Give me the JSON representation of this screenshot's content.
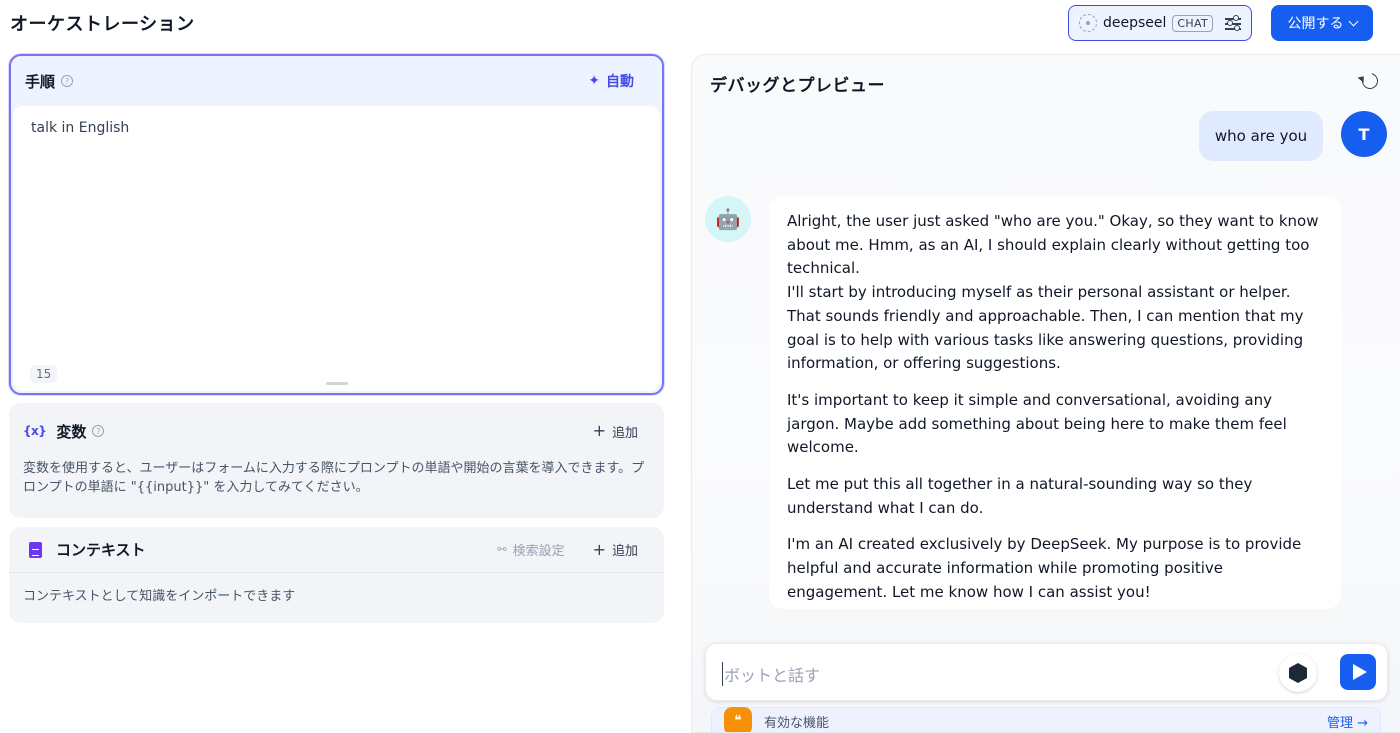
{
  "header": {
    "title": "オーケストレーション",
    "model": {
      "name": "deepseel",
      "badge": "CHAT"
    },
    "publish_label": "公開する"
  },
  "instructions": {
    "title": "手順",
    "help": "?",
    "auto_label": "自動",
    "text": "talk in English",
    "char_count": "15"
  },
  "variables": {
    "icon": "{x}",
    "title": "変数",
    "help": "?",
    "add_label": "追加",
    "description": "変数を使用すると、ユーザーはフォームに入力する際にプロンプトの単語や開始の言葉を導入できます。プロンプトの単語に \"{{input}}\" を入力してみてください。"
  },
  "context": {
    "title": "コンテキスト",
    "retrieval_label": "検索設定",
    "add_label": "追加",
    "description": "コンテキストとして知識をインポートできます"
  },
  "debug": {
    "title": "デバッグとプレビュー",
    "user_message": "who are you",
    "user_initial": "T",
    "bot_paragraphs": [
      "Alright, the user just asked \"who are you.\" Okay, so they want to know about me. Hmm, as an AI, I should explain clearly without getting too technical.\nI'll start by introducing myself as their personal assistant or helper. That sounds friendly and approachable. Then, I can mention that my goal is to help with various tasks like answering questions, providing information, or offering suggestions.",
      "It's important to keep it simple and conversational, avoiding any jargon. Maybe add something about being here to make them feel welcome.",
      "Let me put this all together in a natural-sounding way so they understand what I can do.",
      "I'm an AI created exclusively by DeepSeek. My purpose is to provide helpful and accurate information while promoting positive engagement. Let me know how I can assist you!"
    ],
    "input_placeholder": "ボットと話す",
    "features_label": "有効な機能",
    "manage_label": "管理 →"
  },
  "colors": {
    "accent": "#155eef",
    "indigo": "#444ce7",
    "feature": "#f79009"
  }
}
